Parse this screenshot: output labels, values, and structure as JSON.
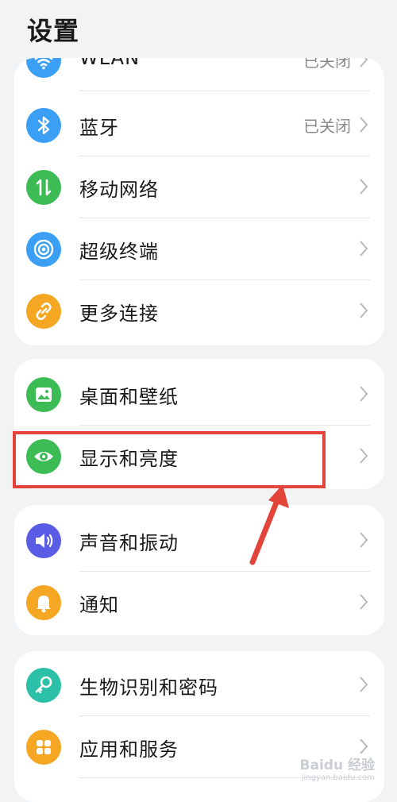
{
  "header": {
    "title": "设置"
  },
  "group1": [
    {
      "label": "WLAN",
      "value": "已关闭",
      "icon": "wifi-icon",
      "color": "#3ba0f5"
    },
    {
      "label": "蓝牙",
      "value": "已关闭",
      "icon": "bluetooth-icon",
      "color": "#3ba0f5"
    },
    {
      "label": "移动网络",
      "value": "",
      "icon": "mobile-data-icon",
      "color": "#3dbb55"
    },
    {
      "label": "超级终端",
      "value": "",
      "icon": "super-device-icon",
      "color": "#3ba0f5"
    },
    {
      "label": "更多连接",
      "value": "",
      "icon": "link-icon",
      "color": "#f5a623"
    }
  ],
  "group2": [
    {
      "label": "桌面和壁纸",
      "icon": "wallpaper-icon",
      "color": "#3dbb55"
    },
    {
      "label": "显示和亮度",
      "icon": "eye-icon",
      "color": "#3dbb55"
    }
  ],
  "group3": [
    {
      "label": "声音和振动",
      "icon": "speaker-icon",
      "color": "#5b5ce6"
    },
    {
      "label": "通知",
      "icon": "bell-icon",
      "color": "#f5a623"
    }
  ],
  "group4": [
    {
      "label": "生物识别和密码",
      "icon": "key-icon",
      "color": "#2bc0a7"
    },
    {
      "label": "应用和服务",
      "icon": "apps-icon",
      "color": "#f5a623"
    }
  ],
  "watermark": {
    "text": "Baidu 经验",
    "sub": "jingyan.baidu.com"
  }
}
